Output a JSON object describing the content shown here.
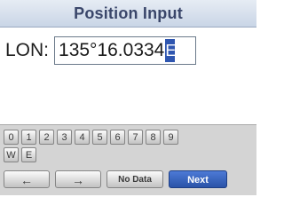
{
  "title": "Position Input",
  "lon": {
    "label": "LON:",
    "value": "135°16.0334",
    "cursor": "E"
  },
  "keypad": {
    "digits": [
      "0",
      "1",
      "2",
      "3",
      "4",
      "5",
      "6",
      "7",
      "8",
      "9"
    ],
    "hemispheres": [
      "W",
      "E"
    ],
    "left_arrow": "←",
    "right_arrow": "→",
    "no_data": "No Data",
    "next": "Next"
  },
  "colors": {
    "title_bar": "#c9d5e6",
    "title_text": "#3a466a",
    "cursor": "#2f56b0",
    "next_button": "#2a53a8",
    "keypad_bg": "#d4d4d4"
  }
}
